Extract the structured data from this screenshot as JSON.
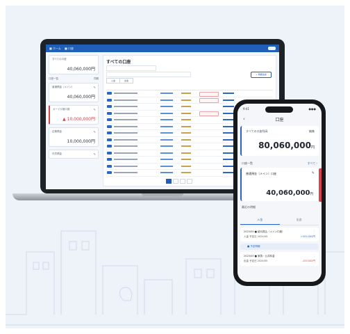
{
  "colors": {
    "primary": "#1f5fb8",
    "expense_red": "#d9434b",
    "background": "#eef3fa"
  },
  "laptop": {
    "nav_tabs": [
      "■ ホーム",
      "■ 口座"
    ],
    "side_header": {
      "left": "口座一覧",
      "right": "同期"
    },
    "total_card": {
      "label": "すべての口座",
      "amount": "40,060,000円"
    },
    "accounts": [
      {
        "name": "普通預金（メイン）",
        "amount": "40,060,000円",
        "red": false
      },
      {
        "name": "カード引落口座",
        "amount": "▲ 10,000,000円",
        "red": true
      },
      {
        "name": "定期預金",
        "amount": "10,000,000円",
        "red": false
      },
      {
        "name": "外貨預金",
        "amount": "",
        "red": false
      }
    ],
    "main_title": "すべての口座",
    "seg_buttons": [
      "入金",
      "出金"
    ],
    "add_button": "+ 明細追加"
  },
  "phone": {
    "status": {
      "time": "9:41",
      "signal": "●●●"
    },
    "title": "口座",
    "back": "‹",
    "total_label": "すべての口座残高",
    "total_edit": "編集",
    "total_amount": "80,060,000",
    "currency": "円",
    "section_accounts": "口座一覧",
    "section_accounts_link": "すべて ›",
    "account_name": "普通預金（メイン）口座",
    "account_amount": "40,060,000",
    "section_details": "最近の明細",
    "tabs": [
      "入金",
      "出金"
    ],
    "items": [
      {
        "title": "2023/05 ■ 給与振込（メイン口座）",
        "left": "入金 予定日 2024/05",
        "right": "+300,000円",
        "red": false
      },
      {
        "title": "2023/05 ■ 家賃・公共料金",
        "left": "出金 予定日 2024/05",
        "right": "-100,000円",
        "red": true
      }
    ],
    "pill": "■ 予定明細"
  }
}
